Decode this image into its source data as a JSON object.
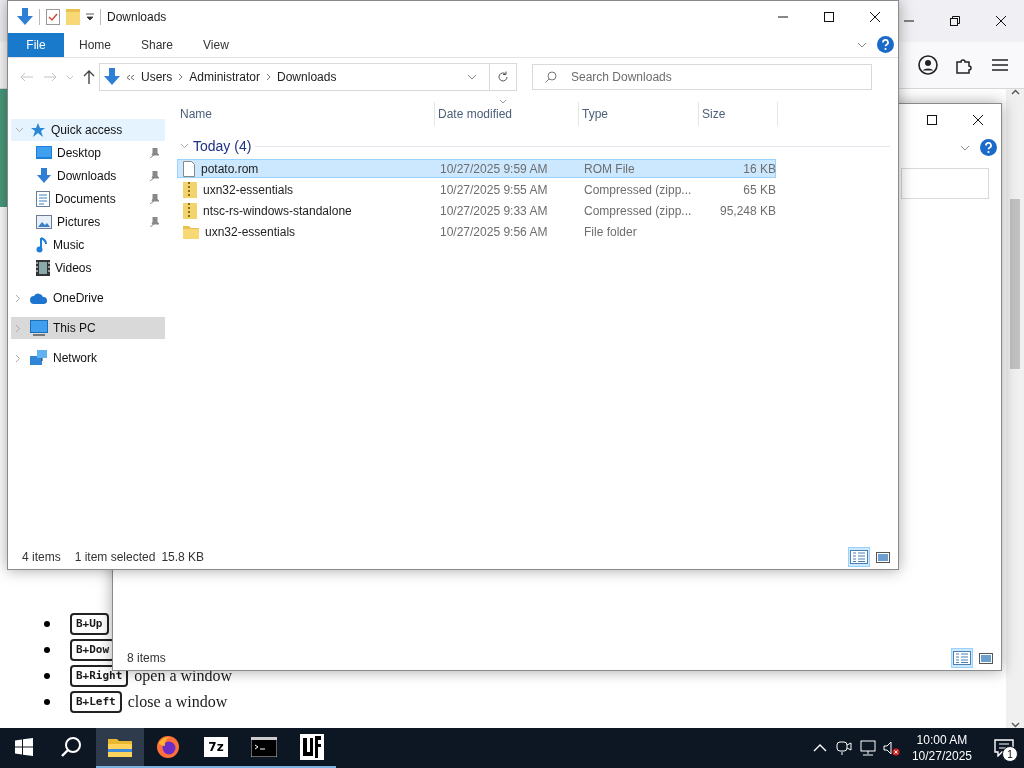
{
  "browser": {
    "page": {
      "shortcuts": [
        {
          "key": "B+Up"
        },
        {
          "key": "B+Dow"
        },
        {
          "key": "B+Right",
          "description": "open a window"
        },
        {
          "key": "B+Left",
          "description": "close a window"
        }
      ]
    }
  },
  "back_window": {
    "status_bar": {
      "item_count": "8 items"
    },
    "view_buttons": [
      {
        "kind": "details",
        "selected": true
      },
      {
        "kind": "large_icons",
        "selected": false
      }
    ]
  },
  "window": {
    "title": "Downloads",
    "ribbon_tabs": [
      {
        "label": "File",
        "kind": "file"
      },
      {
        "label": "Home",
        "kind": "tab"
      },
      {
        "label": "Share",
        "kind": "tab"
      },
      {
        "label": "View",
        "kind": "tab"
      }
    ],
    "address": {
      "path": [
        "Users",
        "Administrator",
        "Downloads"
      ]
    },
    "search": {
      "placeholder": "Search Downloads"
    },
    "nav_pane": {
      "items": [
        {
          "label": "Quick access",
          "kind": "quick_access",
          "expanded": true,
          "hovered": true,
          "selected": false,
          "children": [
            {
              "label": "Desktop",
              "kind": "desktop",
              "pinned": true,
              "hovered": false,
              "selected": false
            },
            {
              "label": "Downloads",
              "kind": "downloads",
              "pinned": true,
              "hovered": false,
              "selected": false
            },
            {
              "label": "Documents",
              "kind": "documents",
              "pinned": true,
              "hovered": false,
              "selected": false
            },
            {
              "label": "Pictures",
              "kind": "pictures",
              "pinned": true,
              "hovered": false,
              "selected": false
            },
            {
              "label": "Music",
              "kind": "music",
              "pinned": false,
              "hovered": false,
              "selected": false
            },
            {
              "label": "Videos",
              "kind": "videos",
              "pinned": false,
              "hovered": false,
              "selected": false
            }
          ]
        },
        {
          "label": "OneDrive",
          "kind": "onedrive",
          "expanded": false,
          "hovered": false,
          "selected": false
        },
        {
          "label": "This PC",
          "kind": "this_pc",
          "expanded": false,
          "hovered": false,
          "selected": true
        },
        {
          "label": "Network",
          "kind": "network",
          "expanded": false,
          "hovered": false,
          "selected": false
        }
      ]
    },
    "columns": [
      {
        "label": "Name",
        "sorted": false
      },
      {
        "label": "Date modified",
        "sorted": true
      },
      {
        "label": "Type",
        "sorted": false
      },
      {
        "label": "Size",
        "sorted": false
      }
    ],
    "group": {
      "label": "Today (4)",
      "expanded": true
    },
    "rows": [
      {
        "name": "potato.rom",
        "date": "10/27/2025 9:59 AM",
        "type": "ROM File",
        "size": "16 KB",
        "kind": "file",
        "selected": true
      },
      {
        "name": "uxn32-essentials",
        "date": "10/27/2025 9:55 AM",
        "type": "Compressed (zipp...",
        "size": "65 KB",
        "kind": "zip",
        "selected": false
      },
      {
        "name": "ntsc-rs-windows-standalone",
        "date": "10/27/2025 9:33 AM",
        "type": "Compressed (zipp...",
        "size": "95,248 KB",
        "kind": "zip",
        "selected": false
      },
      {
        "name": "uxn32-essentials",
        "date": "10/27/2025 9:56 AM",
        "type": "File folder",
        "size": "",
        "kind": "folder",
        "selected": false
      }
    ],
    "status_bar": {
      "item_count": "4 items",
      "selection": "1 item selected",
      "selection_size": "15.8 KB"
    },
    "view_buttons": [
      {
        "kind": "details",
        "selected": true
      },
      {
        "kind": "large_icons",
        "selected": false
      }
    ]
  },
  "taskbar": {
    "apps": [
      {
        "kind": "start",
        "running": false,
        "active": false
      },
      {
        "kind": "search",
        "running": false,
        "active": false
      },
      {
        "kind": "explorer",
        "running": true,
        "active": true
      },
      {
        "kind": "firefox",
        "running": true,
        "active": false
      },
      {
        "kind": "archiver",
        "label": "7z",
        "running": true,
        "active": false
      },
      {
        "kind": "terminal",
        "running": true,
        "active": false
      },
      {
        "kind": "app",
        "running": true,
        "active": false
      }
    ],
    "clock": {
      "time": "10:00 AM",
      "date": "10/27/2025"
    },
    "notifications": {
      "count": "1"
    }
  }
}
